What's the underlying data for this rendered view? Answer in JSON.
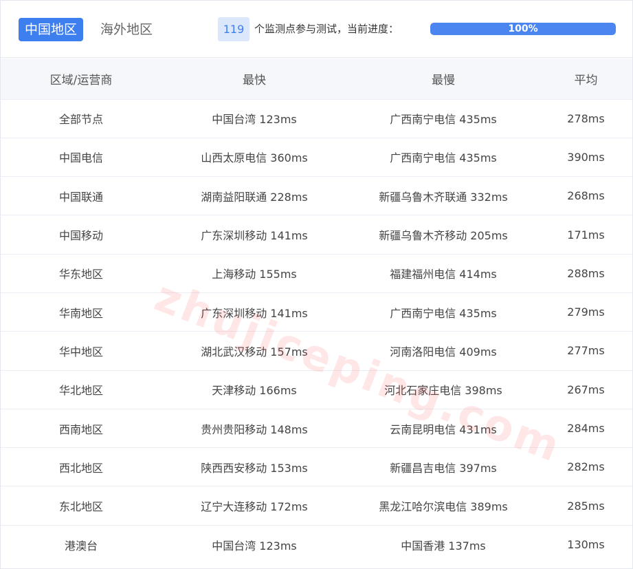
{
  "tabs": {
    "active": "中国地区",
    "inactive": "海外地区"
  },
  "progress": {
    "count": "119",
    "text": "个监测点参与测试，当前进度：",
    "label": "100%",
    "value": 100
  },
  "table": {
    "headers": [
      "区域/运营商",
      "最快",
      "最慢",
      "平均"
    ],
    "rows": [
      [
        "全部节点",
        "中国台湾 123ms",
        "广西南宁电信 435ms",
        "278ms"
      ],
      [
        "中国电信",
        "山西太原电信 360ms",
        "广西南宁电信 435ms",
        "390ms"
      ],
      [
        "中国联通",
        "湖南益阳联通 228ms",
        "新疆乌鲁木齐联通 332ms",
        "268ms"
      ],
      [
        "中国移动",
        "广东深圳移动 141ms",
        "新疆乌鲁木齐移动 205ms",
        "171ms"
      ],
      [
        "华东地区",
        "上海移动 155ms",
        "福建福州电信 414ms",
        "288ms"
      ],
      [
        "华南地区",
        "广东深圳移动 141ms",
        "广西南宁电信 435ms",
        "279ms"
      ],
      [
        "华中地区",
        "湖北武汉移动 157ms",
        "河南洛阳电信 409ms",
        "277ms"
      ],
      [
        "华北地区",
        "天津移动 166ms",
        "河北石家庄电信 398ms",
        "267ms"
      ],
      [
        "西南地区",
        "贵州贵阳移动 148ms",
        "云南昆明电信 431ms",
        "284ms"
      ],
      [
        "西北地区",
        "陕西西安移动 153ms",
        "新疆昌吉电信 397ms",
        "282ms"
      ],
      [
        "东北地区",
        "辽宁大连移动 172ms",
        "黑龙江哈尔滨电信 389ms",
        "285ms"
      ],
      [
        "港澳台",
        "中国台湾 123ms",
        "中国香港 137ms",
        "130ms"
      ]
    ]
  },
  "watermark": "zhujiceping.com",
  "colors": {
    "accent": "#3e7ff0",
    "badge_bg": "#dbe7fb",
    "header_bg": "#f5f7fa"
  }
}
